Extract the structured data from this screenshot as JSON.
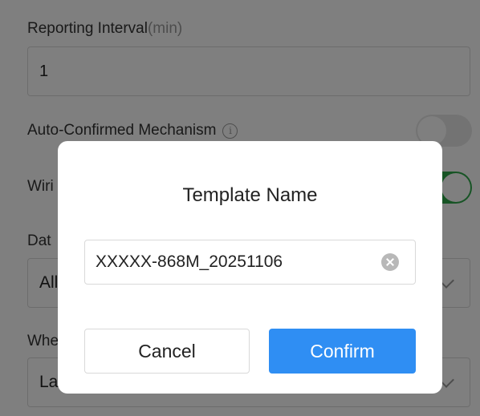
{
  "form": {
    "reporting_interval": {
      "label": "Reporting Interval",
      "unit": "(min)",
      "value": "1"
    },
    "auto_confirmed": {
      "label": "Auto-Confirmed Mechanism",
      "info_glyph": "i",
      "enabled": false
    },
    "wiring": {
      "label": "Wiri",
      "enabled": true
    },
    "data": {
      "label": "Dat",
      "value": "All"
    },
    "when": {
      "label": "Whe",
      "value": "La"
    }
  },
  "dialog": {
    "title": "Template Name",
    "input_value": "XXXXX-868M_20251106",
    "cancel_label": "Cancel",
    "confirm_label": "Confirm"
  },
  "colors": {
    "primary": "#2f8ef3",
    "toggle_on": "#2ea84a",
    "overlay": "rgba(0,0,0,0.5)"
  }
}
